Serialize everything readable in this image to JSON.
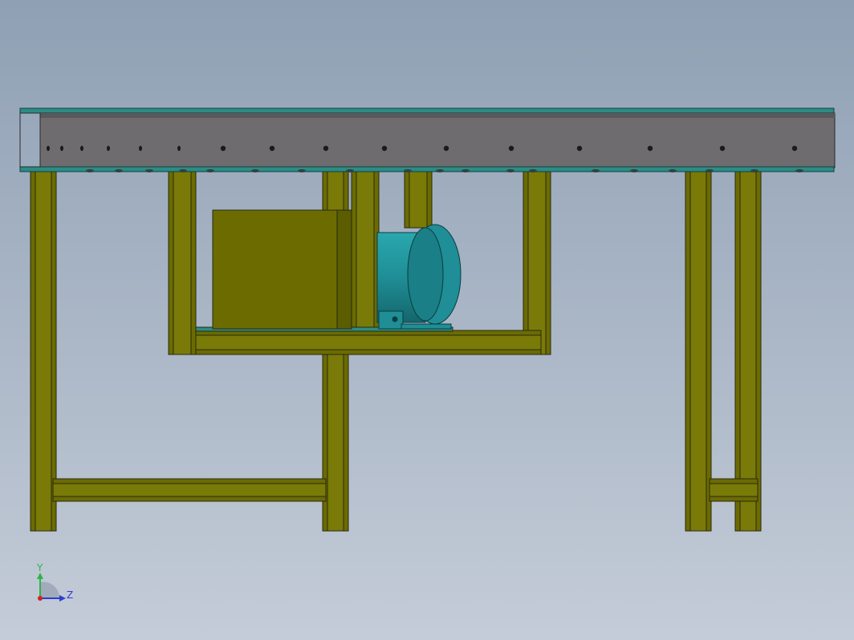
{
  "viewport": {
    "background_top": "#8fa0b4",
    "background_bottom": "#c4ccd8"
  },
  "colors": {
    "frame": "#6b6b00",
    "frame_highlight": "#8a8a10",
    "frame_shadow": "#4e4e00",
    "outline": "#2a2a10",
    "rail": "#6e6c6e",
    "rail_top": "#2b8c86",
    "motor": "#1f8e96",
    "motor_dark": "#14666c",
    "hole": "#1a1a1a"
  },
  "triad": {
    "y_label": "Y",
    "z_label": "Z",
    "y_color": "#2fb34a",
    "z_color": "#2b3fd1",
    "origin_color": "#d22020"
  }
}
